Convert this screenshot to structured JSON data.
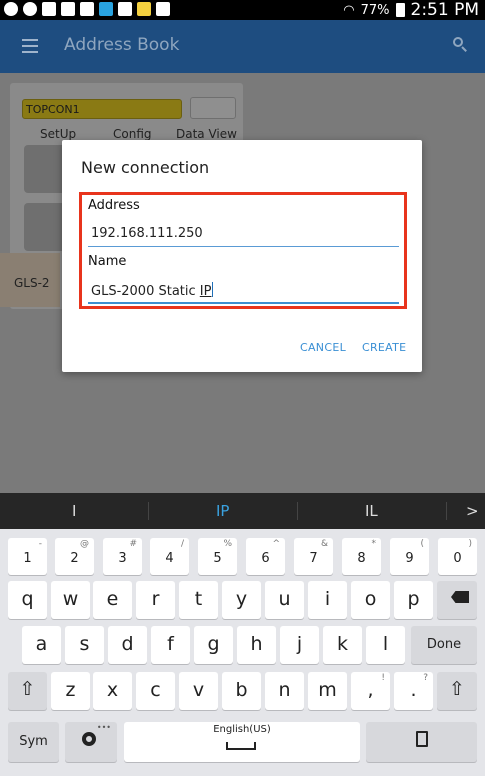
{
  "status_bar": {
    "battery": "77%",
    "time": "2:51 PM",
    "icons": [
      "opera-icon",
      "shield-icon",
      "wrench-icon",
      "photo-icon",
      "image-icon",
      "bluetooth-icon",
      "warning-icon",
      "folder-icon",
      "check-icon"
    ]
  },
  "app_bar": {
    "title": "Address Book",
    "menu_icon": "hamburger-icon",
    "search_icon": "search-icon"
  },
  "background": {
    "device_name": "TOPCON1",
    "labels": [
      "SetUp",
      "Config",
      "Data View"
    ],
    "gls_label": "GLS-2"
  },
  "dialog": {
    "title": "New connection",
    "address_label": "Address",
    "address_value": "192.168.111.250",
    "name_label": "Name",
    "name_value_prefix": "GLS-2000 Static ",
    "name_value_composing": "IP",
    "cancel_label": "CANCEL",
    "create_label": "CREATE"
  },
  "suggestions": [
    "I",
    "IP",
    "IL",
    ">"
  ],
  "keyboard": {
    "numbers": [
      {
        "main": "1",
        "sup": "-"
      },
      {
        "main": "2",
        "sup": "@"
      },
      {
        "main": "3",
        "sup": "#"
      },
      {
        "main": "4",
        "sup": "/"
      },
      {
        "main": "5",
        "sup": "%"
      },
      {
        "main": "6",
        "sup": "^"
      },
      {
        "main": "7",
        "sup": "&"
      },
      {
        "main": "8",
        "sup": "*"
      },
      {
        "main": "9",
        "sup": "("
      },
      {
        "main": "0",
        "sup": ")"
      }
    ],
    "row1": [
      "q",
      "w",
      "e",
      "r",
      "t",
      "y",
      "u",
      "i",
      "o",
      "p"
    ],
    "row2": [
      "a",
      "s",
      "d",
      "f",
      "g",
      "h",
      "j",
      "k",
      "l"
    ],
    "done_label": "Done",
    "row3": [
      "z",
      "x",
      "c",
      "v",
      "b",
      "n",
      "m"
    ],
    "comma": {
      "main": ",",
      "sup": "!"
    },
    "period": {
      "main": ".",
      "sup": "?"
    },
    "sym_label": "Sym",
    "space_label": "English(US)"
  }
}
